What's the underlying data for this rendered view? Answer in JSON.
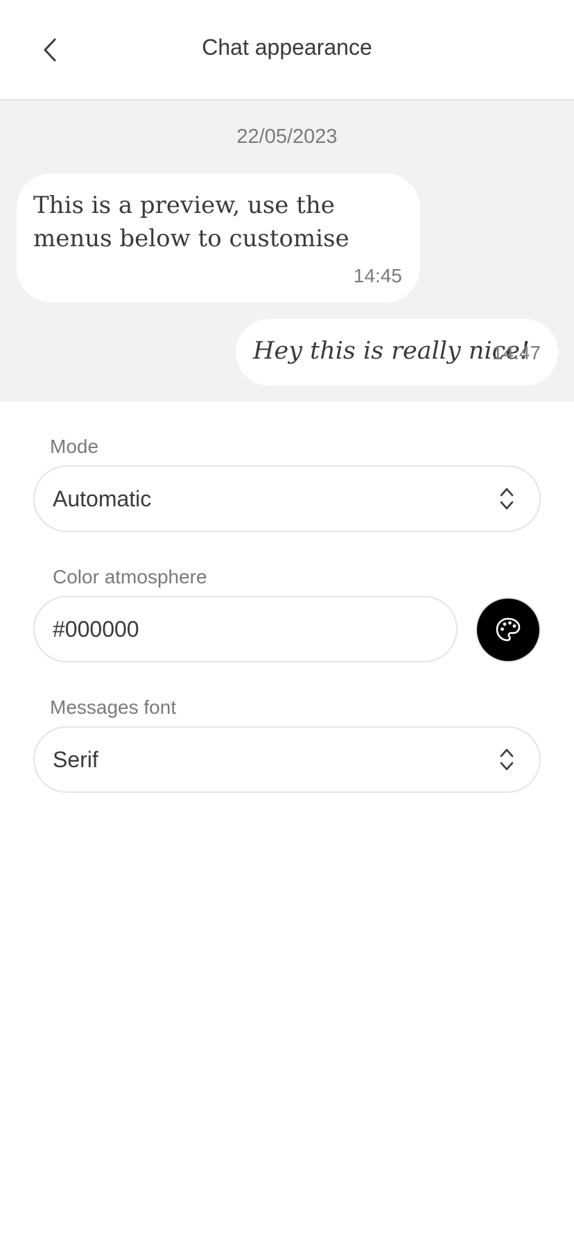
{
  "header": {
    "title": "Chat appearance",
    "back_icon": "chevron-left-icon"
  },
  "preview": {
    "date": "22/05/2023",
    "incoming": {
      "text": "This is a preview, use the menus below to customise",
      "time": "14:45"
    },
    "outgoing": {
      "text": "Hey this is really nice!",
      "time": "14:47"
    }
  },
  "form": {
    "mode": {
      "label": "Mode",
      "value": "Automatic",
      "icon": "chevron-up-down-icon"
    },
    "color": {
      "label": "Color atmosphere",
      "value": "#000000",
      "picker_icon": "palette-icon",
      "swatch": "#000000"
    },
    "font": {
      "label": "Messages font",
      "value": "Serif",
      "icon": "chevron-up-down-icon"
    }
  },
  "colors": {
    "preview_background": "#f2f2f2",
    "bubble_background": "#ffffff",
    "text_primary": "#3a3a3a",
    "text_secondary": "#7a7a7a",
    "border": "#e4e4e4"
  }
}
